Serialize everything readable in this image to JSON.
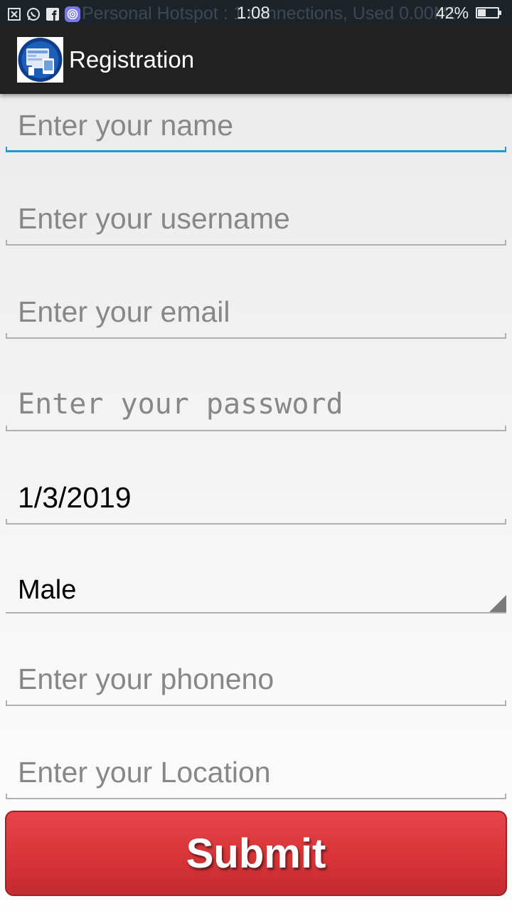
{
  "status_bar": {
    "ticker_text": "Personal Hotspot : 1 connections, Used 0.00MB",
    "time": "1:08",
    "battery_percent_text": "42%",
    "battery_level": 0.42,
    "icons": [
      "close-notification-icon",
      "whatsapp-icon",
      "facebook-icon",
      "hotspot-icon"
    ]
  },
  "app_bar": {
    "title": "Registration",
    "icon": "registration-app-icon"
  },
  "form": {
    "name": {
      "placeholder": "Enter your name",
      "value": ""
    },
    "username": {
      "placeholder": "Enter your username",
      "value": ""
    },
    "email": {
      "placeholder": "Enter your email",
      "value": ""
    },
    "password": {
      "placeholder": "Enter your password",
      "value": ""
    },
    "dob": {
      "value": "1/3/2019"
    },
    "gender": {
      "selected": "Male"
    },
    "phone": {
      "placeholder": "Enter your phoneno",
      "value": ""
    },
    "location": {
      "placeholder": "Enter your Location",
      "value": ""
    },
    "submit_label": "Submit"
  },
  "colors": {
    "focus_underline": "#1f9ac9",
    "submit_button": "#d83438",
    "action_bar": "#212121",
    "status_bar": "#1c2329"
  }
}
